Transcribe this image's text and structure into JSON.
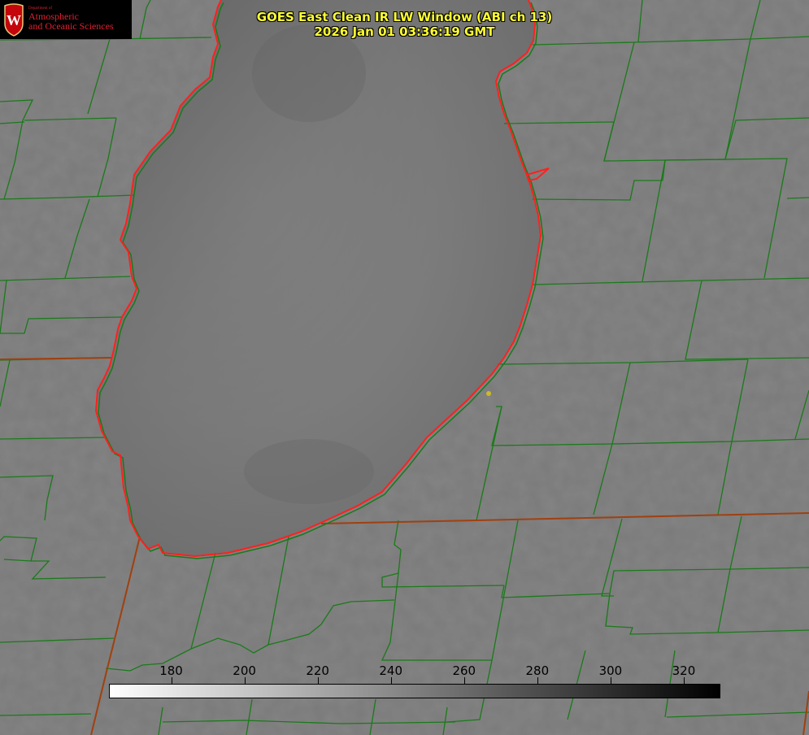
{
  "title": {
    "line1": "GOES East Clean IR LW Window (ABI ch 13)",
    "line2": "2026 Jan 01 03:36:19 GMT"
  },
  "logo": {
    "department": "Department of",
    "line1": "Atmospheric",
    "line2": "and Oceanic Sciences",
    "shield_letter": "W"
  },
  "colorbar": {
    "min": 163,
    "max": 330,
    "ticks": [
      "180",
      "200",
      "220",
      "240",
      "260",
      "280",
      "300",
      "320"
    ],
    "gradient": "white to black"
  },
  "colors": {
    "background_gray": "#7a7a7a",
    "lake_shoreline": "#ff2020",
    "county_lines": "#1a7a1a",
    "state_line": "#a04010",
    "title_text": "#ffff33",
    "marker": "#ccbb22"
  },
  "map_layers": {
    "imagery": "infrared brightness temperature",
    "lake": "Lake Okeechobee style inland lake",
    "boundaries": "county boundaries"
  }
}
